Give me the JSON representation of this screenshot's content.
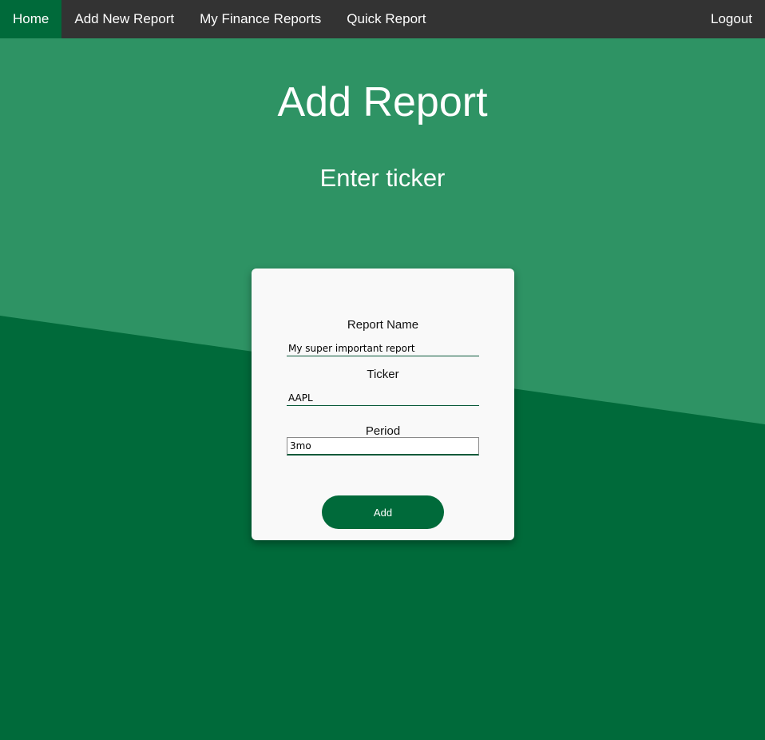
{
  "nav": {
    "items": [
      {
        "label": "Home",
        "active": true
      },
      {
        "label": "Add New Report",
        "active": false
      },
      {
        "label": "My Finance Reports",
        "active": false
      },
      {
        "label": "Quick Report",
        "active": false
      }
    ],
    "logout_label": "Logout"
  },
  "page": {
    "title": "Add Report",
    "subtitle": "Enter ticker"
  },
  "form": {
    "report_name": {
      "label": "Report Name",
      "value": "My super important report"
    },
    "ticker": {
      "label": "Ticker",
      "value": "AAPL"
    },
    "period": {
      "label": "Period",
      "value": "3mo"
    },
    "submit_label": "Add"
  },
  "colors": {
    "primary_green": "#006a3a",
    "light_green": "#2e9364",
    "navbar": "#333333",
    "card": "#f9f9f9"
  }
}
